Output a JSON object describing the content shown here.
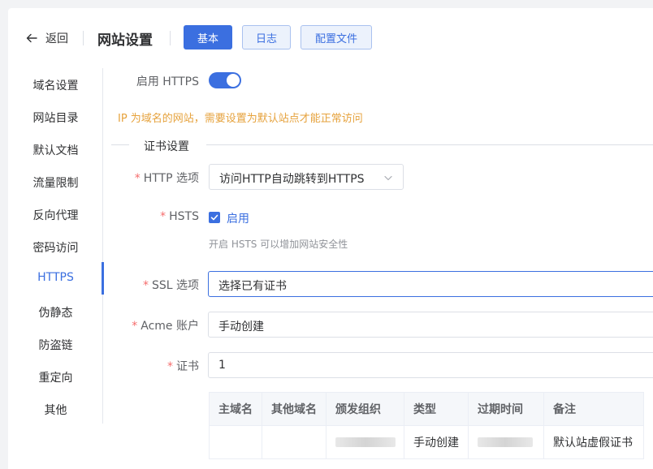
{
  "header": {
    "back_label": "返回",
    "title": "网站设置",
    "tabs": [
      {
        "label": "基本",
        "active": true
      },
      {
        "label": "日志",
        "active": false
      },
      {
        "label": "配置文件",
        "active": false
      }
    ]
  },
  "menu": {
    "items": [
      "域名设置",
      "网站目录",
      "默认文档",
      "流量限制",
      "反向代理",
      "密码访问",
      "HTTPS",
      "伪静态",
      "防盗链",
      "重定向",
      "其他"
    ],
    "active": "HTTPS"
  },
  "form": {
    "enable_https_label": "启用 HTTPS",
    "enable_https_on": true,
    "warning": "IP 为域名的网站，需要设置为默认站点才能正常访问",
    "section_title": "证书设置",
    "http_option_label": "HTTP 选项",
    "http_option_value": "访问HTTP自动跳转到HTTPS",
    "hsts_label": "HSTS",
    "hsts_checkbox_label": "启用",
    "hsts_checked": true,
    "hsts_hint": "开启 HSTS 可以增加网站安全性",
    "ssl_label": "SSL 选项",
    "ssl_value": "选择已有证书",
    "acme_label": "Acme 账户",
    "acme_value": "手动创建",
    "cert_label": "证书",
    "cert_value": "1",
    "required_mark": "*"
  },
  "table": {
    "headers": [
      "主域名",
      "其他域名",
      "颁发组织",
      "类型",
      "过期时间",
      "备注"
    ],
    "rows": [
      {
        "primary": "",
        "others": "",
        "issuer": "",
        "type": "手动创建",
        "expiry": "",
        "remark": "默认站虚假证书"
      }
    ]
  },
  "colors": {
    "primary": "#3b6fe0",
    "warning": "#e6a23c",
    "required": "#f56c6c"
  }
}
